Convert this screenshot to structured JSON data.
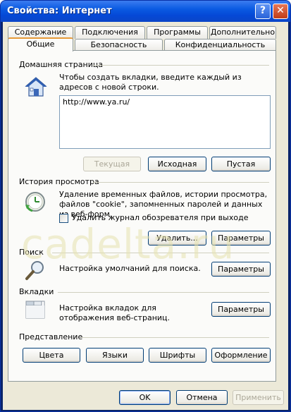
{
  "window": {
    "title": "Свойства: Интернет",
    "help_glyph": "?",
    "close_glyph": "✕"
  },
  "tabs": {
    "row1": [
      "Содержание",
      "Подключения",
      "Программы",
      "Дополнительно"
    ],
    "row2": [
      "Общие",
      "Безопасность",
      "Конфиденциальность"
    ],
    "active": "Общие"
  },
  "home_page": {
    "group_title": "Домашняя страница",
    "description": "Чтобы создать вкладки, введите каждый из адресов с новой строки.",
    "url_value": "http://www.ya.ru/",
    "btn_current": "Текущая",
    "btn_default": "Исходная",
    "btn_blank": "Пустая",
    "icon": "house-icon"
  },
  "history": {
    "group_title": "История просмотра",
    "description": "Удаление временных файлов, истории просмотра, файлов \"cookie\", запомненных паролей и данных из веб-форм.",
    "checkbox_label": "Удалить журнал обозревателя при выходе",
    "checkbox_checked": false,
    "btn_delete": "Удалить...",
    "btn_settings": "Параметры",
    "icon": "clock-icon"
  },
  "search": {
    "group_title": "Поиск",
    "description": "Настройка умолчаний для поиска.",
    "btn_settings": "Параметры",
    "icon": "magnifier-icon"
  },
  "tabs_group": {
    "group_title": "Вкладки",
    "description": "Настройка вкладок для отображения веб-страниц.",
    "btn_settings": "Параметры",
    "icon": "tabs-icon"
  },
  "appearance": {
    "group_title": "Представление",
    "btn_colors": "Цвета",
    "btn_languages": "Языки",
    "btn_fonts": "Шрифты",
    "btn_accessibility": "Оформление"
  },
  "footer": {
    "ok": "OK",
    "cancel": "Отмена",
    "apply": "Применить"
  },
  "watermark": "cadelta.ru"
}
